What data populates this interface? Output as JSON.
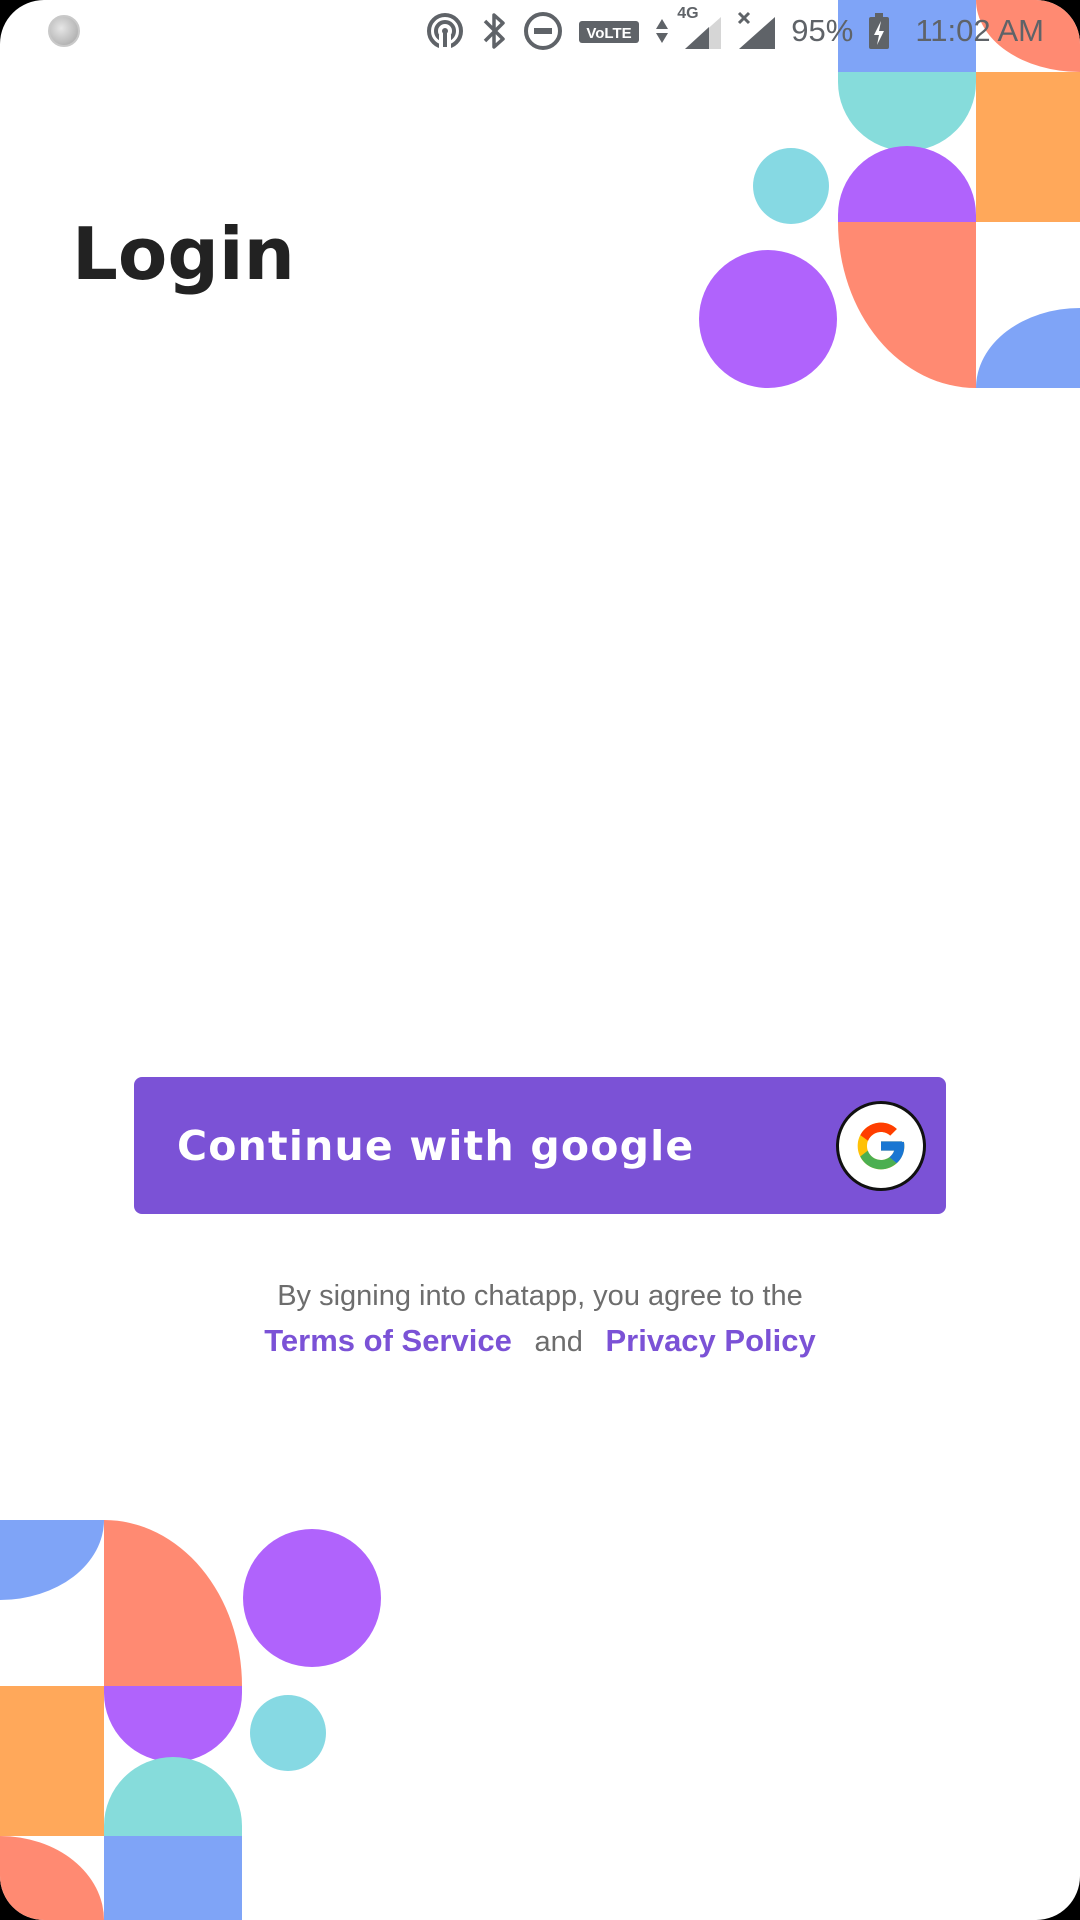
{
  "status_bar": {
    "battery_percent": "95%",
    "time": "11:02 AM",
    "network_label": "4G",
    "volte_label": "VoLTE"
  },
  "page": {
    "title": "Login"
  },
  "google_button": {
    "label": "Continue with google",
    "background_color": "#7b52d6"
  },
  "terms": {
    "line1": "By signing into chatapp, you agree to the",
    "terms_link": "Terms of Service",
    "and_text": "and",
    "privacy_link": "Privacy Policy",
    "link_color": "#7b52d6"
  },
  "decor_colors": {
    "blue": "#7fa4f7",
    "teal": "#86dcdb",
    "orange": "#ffa85a",
    "purple": "#b063fc",
    "coral": "#ff8a72",
    "cyan": "#86d9e3"
  }
}
